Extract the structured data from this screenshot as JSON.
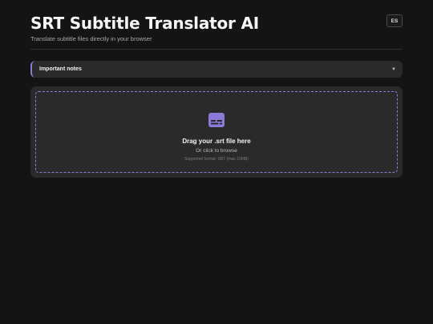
{
  "header": {
    "title": "SRT Subtitle Translator AI",
    "subtitle": "Translate subtitle files directly in your browser",
    "language_button": "ES"
  },
  "notes": {
    "label": "Important notes",
    "expanded": false
  },
  "upload": {
    "icon": "subtitles-icon",
    "title": "Drag your .srt file here",
    "subtitle": "Or click to browse",
    "hint": "Supported format: SRT (max 10MB)"
  },
  "colors": {
    "background": "#141414",
    "card": "#2a2a2a",
    "accent": "#8c7ad6",
    "text_primary": "#f5f5f5",
    "text_muted": "#a9a9a9"
  }
}
